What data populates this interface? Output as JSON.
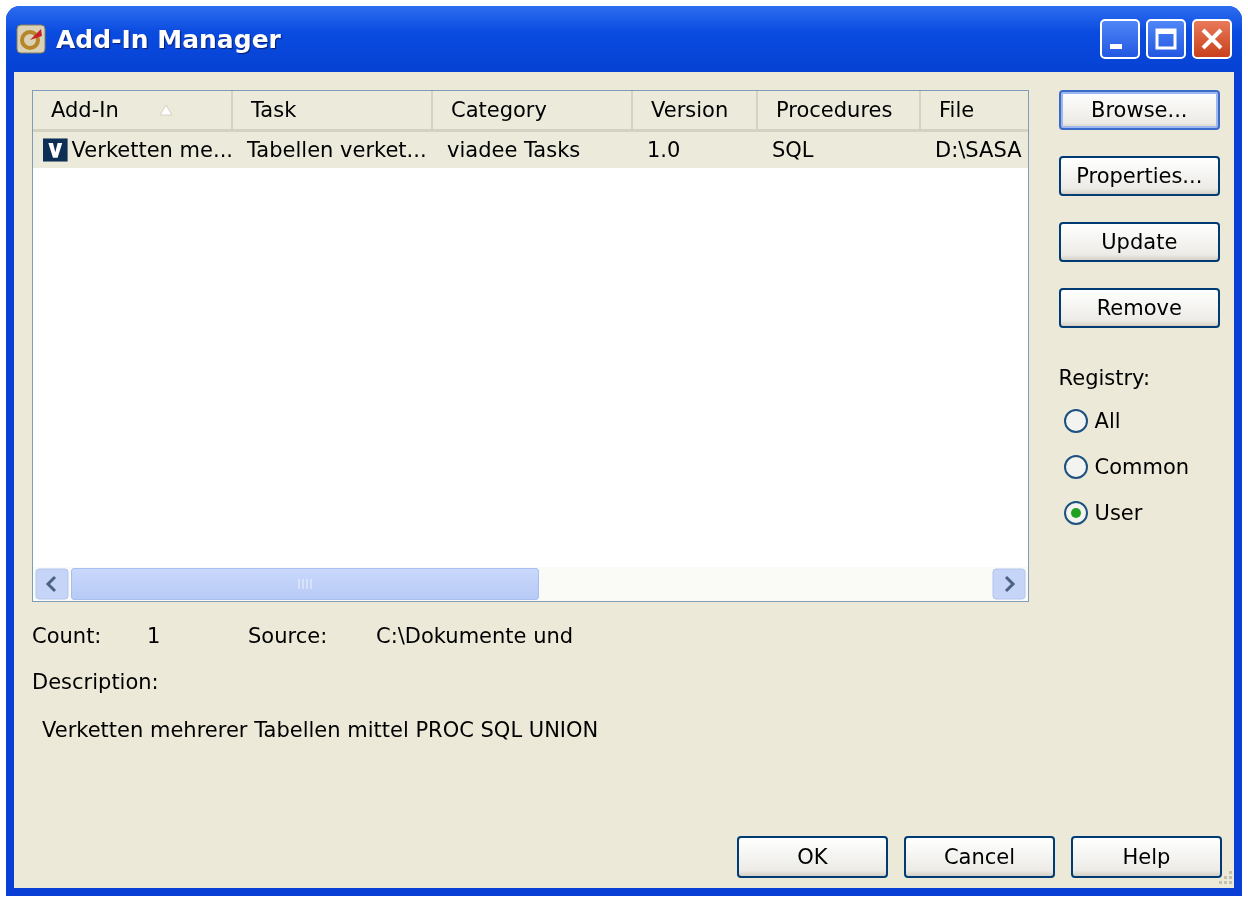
{
  "window": {
    "title": "Add-In Manager"
  },
  "table": {
    "columns": [
      {
        "label": "Add-In",
        "sorted": true
      },
      {
        "label": "Task",
        "sorted": false
      },
      {
        "label": "Category",
        "sorted": false
      },
      {
        "label": "Version",
        "sorted": false
      },
      {
        "label": "Procedures",
        "sorted": false
      },
      {
        "label": "File",
        "sorted": false
      }
    ],
    "rows": [
      {
        "selected": true,
        "cells": [
          "Verketten me...",
          "Tabellen verket...",
          "viadee Tasks",
          "1.0",
          "SQL",
          "D:\\SASA"
        ]
      }
    ]
  },
  "side_buttons": [
    {
      "label": "Browse...",
      "default": true
    },
    {
      "label": "Properties...",
      "default": false
    },
    {
      "label": "Update",
      "default": false
    },
    {
      "label": "Remove",
      "default": false
    }
  ],
  "registry": {
    "label": "Registry:",
    "options": [
      {
        "label": "All",
        "selected": false
      },
      {
        "label": "Common",
        "selected": false
      },
      {
        "label": "User",
        "selected": true
      }
    ]
  },
  "info": {
    "count_label": "Count:",
    "count": "1",
    "source_label": "Source:",
    "source": "C:\\Dokumente und",
    "description_label": "Description:",
    "description": "Verketten mehrerer Tabellen mittel PROC SQL UNION"
  },
  "buttons": [
    "OK",
    "Cancel",
    "Help"
  ]
}
